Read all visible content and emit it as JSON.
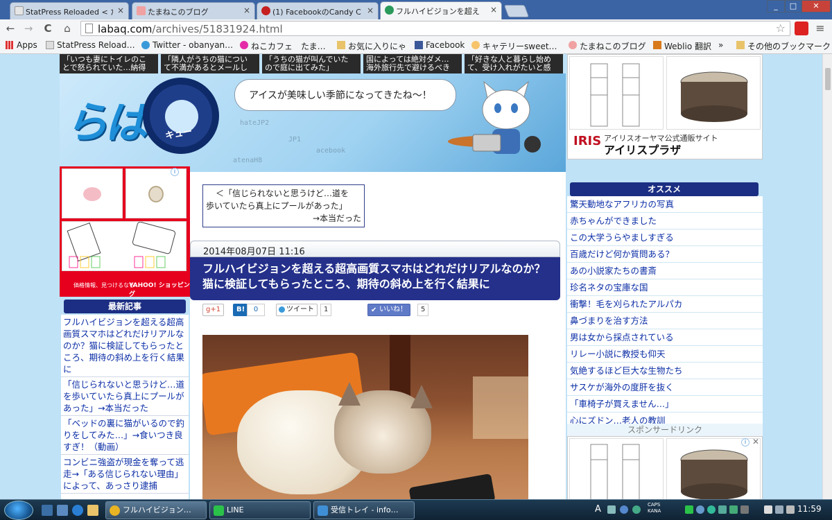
{
  "browser": {
    "tabs": [
      {
        "label": "StatPress Reloaded < た",
        "icon": "page-icon",
        "color": "#e5e5e5"
      },
      {
        "label": "たまねこのブログ",
        "icon": "paw-icon",
        "color": "#f0a1a1"
      },
      {
        "label": "(1) FacebookのCandy C",
        "icon": "candy-icon",
        "color": "#c61f1f"
      },
      {
        "label": "フルハイビジョンを超え",
        "icon": "labaq-icon",
        "color": "#2a9a5b",
        "active": true
      }
    ],
    "tab_close": "×",
    "url_domain": "labaq.com",
    "url_path": "/archives/51831924.html",
    "nav": {
      "back": "←",
      "forward": "→",
      "reload": "C",
      "home": "⌂",
      "star": "☆",
      "menu": "≡"
    },
    "bookmarks": [
      {
        "label": "Apps",
        "icon": "apps-grid-icon",
        "color": "#555"
      },
      {
        "label": "StatPress Reload…",
        "icon": "page-icon",
        "color": "#ddd"
      },
      {
        "label": "Twitter - obanyan…",
        "icon": "twitter-bird-icon",
        "color": "#3a9ad9"
      },
      {
        "label": "ねこカフェ　たま…",
        "icon": "cat-cafe-icon",
        "color": "#e52aa8"
      },
      {
        "label": "お気に入りにゃ",
        "icon": "folder-icon",
        "color": "#e8c36a"
      },
      {
        "label": "Facebook",
        "icon": "facebook-icon",
        "color": "#3b5998"
      },
      {
        "label": "キャテリーsweet…",
        "icon": "cat-face-icon",
        "color": "#f7c46c"
      },
      {
        "label": "たまねこのブログ",
        "icon": "paw-icon",
        "color": "#f0a1a1"
      },
      {
        "label": "Weblio 翻訳",
        "icon": "weblio-icon",
        "color": "#d87a1a"
      }
    ],
    "bookmarks_more": "»",
    "other_bookmarks": "その他のブックマーク"
  },
  "page": {
    "thumb_captions": [
      "「いつも妻にトイレのこ\nとで怒られていた…納得",
      "「隣人がうちの猫につい\nて不満があるとメールし",
      "「うちの猫が叫んでいた\nので庭に出てみた」",
      "国によっては絶対ダメ…\n海外旅行先で避けるべき",
      "「好きな人と暮らし始め\nて、受け入れがたいと感"
    ],
    "logo_text": "らば",
    "logo_q": "Q",
    "logo_kyu": "キュー",
    "speech": "アイスが美味しい季節になってきたね～！",
    "circuit_labels": [
      "hateJP2",
      "JP1",
      "acebook",
      "atenaH8"
    ],
    "right_top_ad": {
      "brand": "IRIS",
      "sub": "アイリスオーヤマ公式通販サイト",
      "name": "アイリスプラザ"
    },
    "left_ad": {
      "caption": "価格情報、見つけるなら",
      "brand": "YAHOO! ショッピング"
    },
    "recent_heading": "最新記事",
    "recent": [
      "フルハイビジョンを超える超高画質スマホはどれだけリアルなのか？猫に検証してもらったところ、期待の斜め上を行く結果に",
      "「信じられないと思うけど…道を歩いていたら真上にプールがあった」→本当だった",
      "「ベッドの裏に猫がいるので釣りをしてみた…」→食いつき良すぎ！（動画）",
      "コンビニ強盗が現金を奪って逃走→「ある信じられない理由」によって、あっさり逮捕"
    ],
    "prev_link": [
      "＜「信じられないと思うけど…道を",
      "歩いていたら真上にプールがあった」",
      "→本当だった"
    ],
    "date": "2014年08月07日 11:16",
    "title": "フルハイビジョンを超える超高画質スマホはどれだけリアルなのか？猫に検証してもらったところ、期待の斜め上を行く結果に",
    "share": {
      "gplus": "g+1",
      "hatena": "B!",
      "hatena_count": "0",
      "tweet": "ツイート",
      "tweet_count": "1",
      "like": "いいね！",
      "like_count": "5"
    },
    "reco_heading": "オススメ",
    "reco": [
      "驚天動地なアフリカの写真",
      "赤ちゃんができました",
      "この大学うらやましすぎる",
      "百歳だけど何か質問ある？",
      "あの小説家たちの書斎",
      "珍名ネタの宝庫な国",
      "衝撃！毛を刈られたアルパカ",
      "鼻づまりを治す方法",
      "男は女から採点されている",
      "リレー小説に教授も仰天",
      "気絶するほど巨大な生物たち",
      "サスケが海外の度肝を抜く",
      "「車椅子が買えません…」",
      "心にズドン…老人の教訓"
    ],
    "sponsor": "スポンサードリンク",
    "ad_info": "i",
    "ad_close": "✕"
  },
  "taskbar": {
    "tasks": [
      {
        "label": "フルハイビジョン…",
        "icon": "chrome-icon",
        "color": "#e8b424"
      },
      {
        "label": "LINE",
        "icon": "line-icon",
        "color": "#2bc24a"
      },
      {
        "label": "受信トレイ - info…",
        "icon": "mail-icon",
        "color": "#3f8fd6"
      }
    ],
    "lang": "A",
    "caps": "CAPS",
    "kana": "KANA",
    "time": "11:59"
  }
}
